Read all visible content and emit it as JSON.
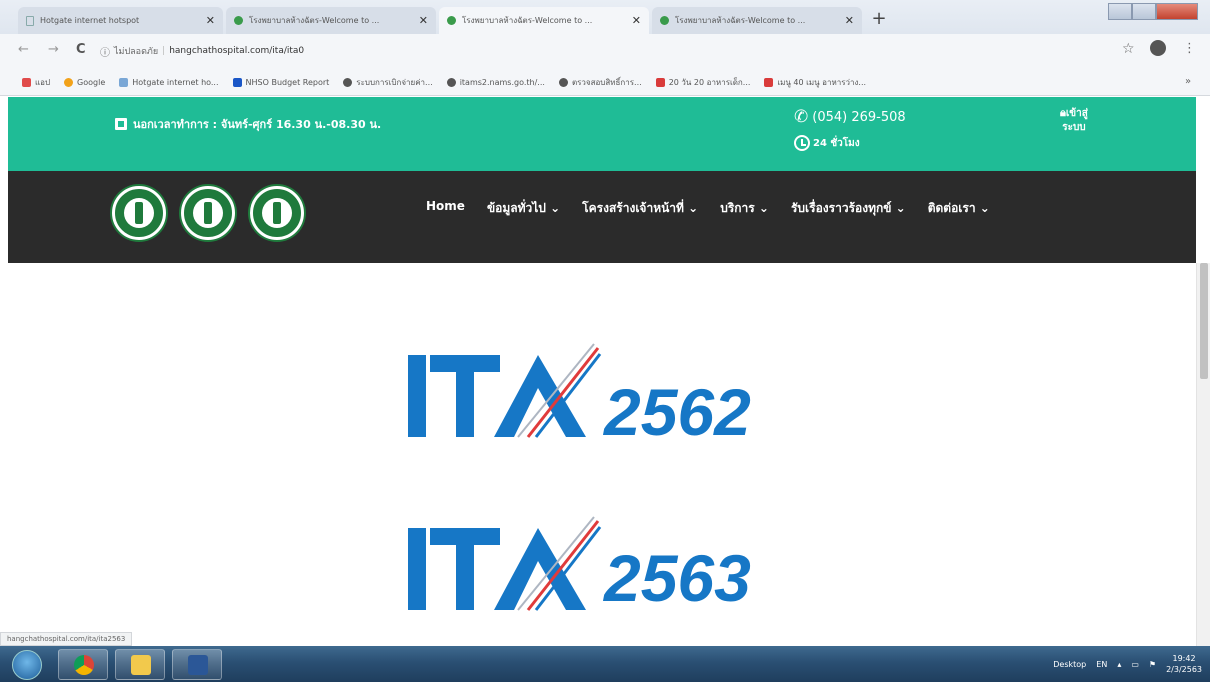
{
  "browser": {
    "tabs": [
      {
        "title": "Hotgate internet hotspot",
        "active": false,
        "favicon": "page"
      },
      {
        "title": "โรงพยาบาลห้างฉัตร-Welcome to ...",
        "active": false,
        "favicon": "globe"
      },
      {
        "title": "โรงพยาบาลห้างฉัตร-Welcome to ...",
        "active": true,
        "favicon": "globe"
      },
      {
        "title": "โรงพยาบาลห้างฉัตร-Welcome to ...",
        "active": false,
        "favicon": "globe"
      }
    ],
    "new_tab_label": "+",
    "nav": {
      "back": "←",
      "forward": "→",
      "reload": "C"
    },
    "security_label": "ไม่ปลอดภัย",
    "url": "hangchathospital.com/ita/ita0",
    "bookmarks": [
      {
        "label": "แอป",
        "color": "#e04b4b"
      },
      {
        "label": "Google",
        "color": "#f2a21a"
      },
      {
        "label": "Hotgate internet ho...",
        "color": "#7aa7d6"
      },
      {
        "label": "NHSO Budget Report",
        "color": "#1a56c7"
      },
      {
        "label": "ระบบการเบิกจ่ายค่า...",
        "color": "#555555"
      },
      {
        "label": "itams2.nams.go.th/...",
        "color": "#555555"
      },
      {
        "label": "ตรวจสอบสิทธิ์การ...",
        "color": "#555555"
      },
      {
        "label": "20 วัน 20 อาหารเด็ก...",
        "color": "#d93b3b"
      },
      {
        "label": "เมนู 40 เมนู อาหารว่าง...",
        "color": "#d93b3b"
      }
    ]
  },
  "site": {
    "topbar": {
      "hours": "นอกเวลาทำการ : จันทร์-ศุกร์ 16.30 น.-08.30 น.",
      "phone": "(054) 269-508",
      "open24": "24 ชั่วโมง",
      "login_line1": "เข้าสู่",
      "login_line2": "ระบบ"
    },
    "menu": [
      {
        "label": "Home",
        "dropdown": false
      },
      {
        "label": "ข้อมูลทั่วไป",
        "dropdown": true
      },
      {
        "label": "โครงสร้างเจ้าหน้าที่",
        "dropdown": true
      },
      {
        "label": "บริการ",
        "dropdown": true
      },
      {
        "label": "รับเรื่องราวร้องทุกข์",
        "dropdown": true
      },
      {
        "label": "ติดต่อเรา",
        "dropdown": true
      }
    ],
    "banners": [
      {
        "prefix": "ITA",
        "year": "2562"
      },
      {
        "prefix": "ITA",
        "year": "2563"
      }
    ],
    "colors": {
      "topbar": "#1fbc96",
      "navbar": "#2b2b2b",
      "ita_blue": "#1677c6",
      "ita_red": "#e03b3b"
    }
  },
  "status_url": "hangchathospital.com/ita/ita2563",
  "taskbar": {
    "desktop_label": "Desktop",
    "lang": "EN",
    "time": "19:42",
    "date": "2/3/2563"
  }
}
